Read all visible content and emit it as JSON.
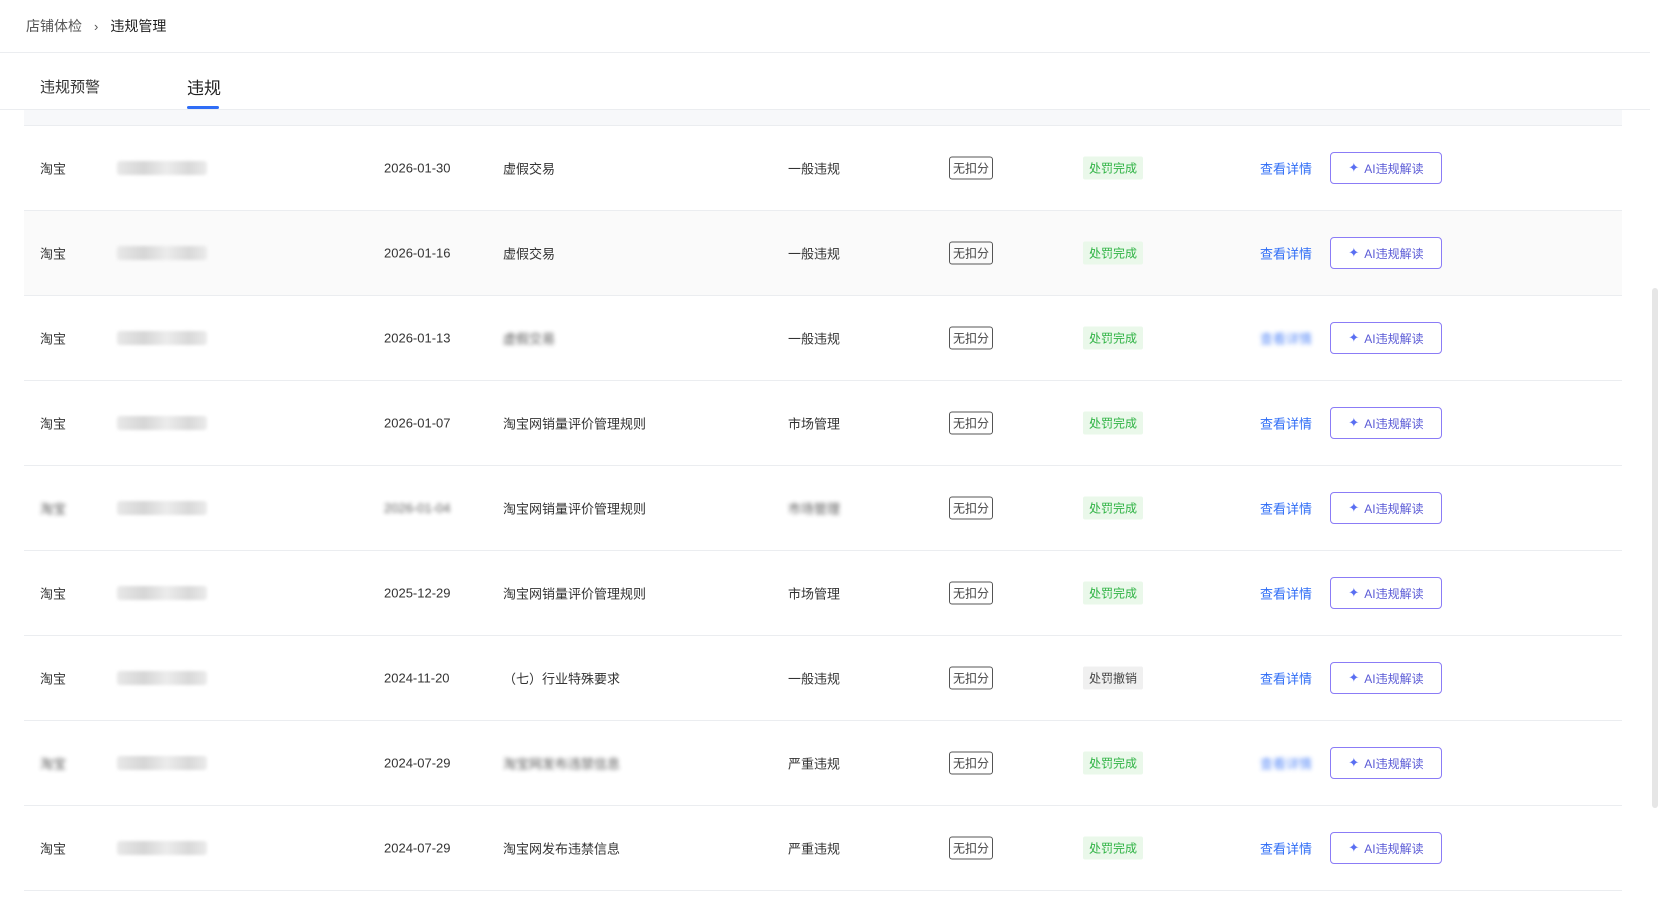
{
  "breadcrumb": {
    "parent": "店铺体检",
    "separator": "›",
    "current": "违规管理"
  },
  "tabs": [
    {
      "label": "违规预警"
    },
    {
      "label": "违规"
    }
  ],
  "row_actions": {
    "detail_label": "查看详情",
    "ai_label": "AI违规解读",
    "ai_icon": "sparkle-icon"
  },
  "rows": [
    {
      "platform": "淘宝",
      "date": "2026-01-30",
      "rule": "虚假交易",
      "type": "一般违规",
      "score": "无扣分",
      "status": "处罚完成"
    },
    {
      "platform": "淘宝",
      "date": "2026-01-16",
      "rule": "虚假交易",
      "type": "一般违规",
      "score": "无扣分",
      "status": "处罚完成"
    },
    {
      "platform": "淘宝",
      "date": "2026-01-13",
      "rule": "虚假交易",
      "type": "一般违规",
      "score": "无扣分",
      "status": "处罚完成"
    },
    {
      "platform": "淘宝",
      "date": "2026-01-07",
      "rule": "淘宝网销量评价管理规则",
      "type": "市场管理",
      "score": "无扣分",
      "status": "处罚完成"
    },
    {
      "platform": "淘宝",
      "date": "2026-01-04",
      "rule": "淘宝网销量评价管理规则",
      "type": "市场管理",
      "score": "无扣分",
      "status": "处罚完成"
    },
    {
      "platform": "淘宝",
      "date": "2025-12-29",
      "rule": "淘宝网销量评价管理规则",
      "type": "市场管理",
      "score": "无扣分",
      "status": "处罚完成"
    },
    {
      "platform": "淘宝",
      "date": "2024-11-20",
      "rule": "（七）行业特殊要求",
      "type": "一般违规",
      "score": "无扣分",
      "status": "处罚撤销"
    },
    {
      "platform": "淘宝",
      "date": "2024-07-29",
      "rule": "淘宝网发布违禁信息",
      "type": "严重违规",
      "score": "无扣分",
      "status": "处罚完成"
    },
    {
      "platform": "淘宝",
      "date": "2024-07-29",
      "rule": "淘宝网发布违禁信息",
      "type": "严重违规",
      "score": "无扣分",
      "status": "处罚完成"
    }
  ],
  "colors": {
    "accent": "#2f6df6",
    "status_done": "#2fb344",
    "ai_border": "#8b7cf6"
  }
}
